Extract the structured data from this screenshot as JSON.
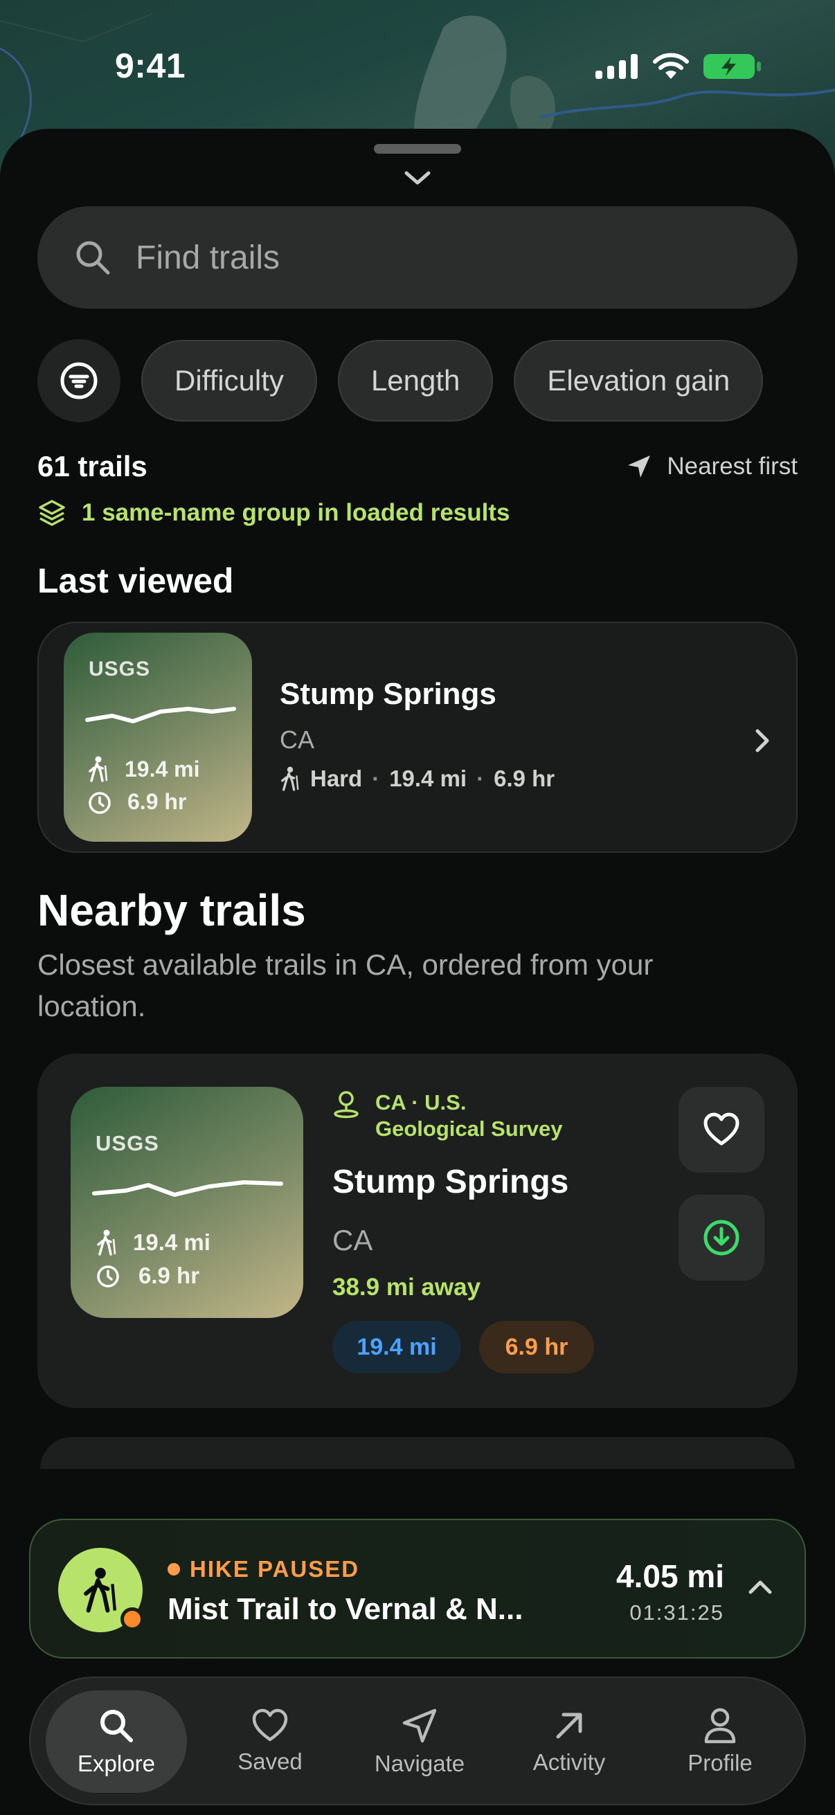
{
  "status_bar": {
    "time": "9:41"
  },
  "search": {
    "placeholder": "Find trails"
  },
  "filters": {
    "chips": [
      "Difficulty",
      "Length",
      "Elevation gain"
    ]
  },
  "results": {
    "count": "61 trails",
    "sort": "Nearest first",
    "group_note": "1 same-name group in loaded results"
  },
  "last_viewed": {
    "heading": "Last viewed",
    "thumb_source": "USGS",
    "thumb_distance": "19.4 mi",
    "thumb_time": "6.9 hr",
    "title": "Stump Springs",
    "state": "CA",
    "difficulty": "Hard",
    "dot": "·",
    "distance": "19.4 mi",
    "time": "6.9 hr"
  },
  "nearby": {
    "heading": "Nearby trails",
    "subtitle": "Closest available trails in CA, ordered from your location.",
    "card": {
      "thumb_source": "USGS",
      "thumb_distance": "19.4 mi",
      "thumb_time": "6.9 hr",
      "location_line1": "CA · U.S.",
      "location_line2": "Geological Survey",
      "title": "Stump Springs",
      "state": "CA",
      "away": "38.9 mi away",
      "pill_distance": "19.4 mi",
      "pill_time": "6.9 hr"
    }
  },
  "hike_banner": {
    "status": "HIKE PAUSED",
    "name": "Mist Trail to Vernal & N...",
    "distance": "4.05 mi",
    "elapsed": "01:31:25"
  },
  "tabs": [
    {
      "label": "Explore",
      "icon": "search-icon"
    },
    {
      "label": "Saved",
      "icon": "heart-icon"
    },
    {
      "label": "Navigate",
      "icon": "navigate-icon"
    },
    {
      "label": "Activity",
      "icon": "arrow-up-right-icon"
    },
    {
      "label": "Profile",
      "icon": "person-icon"
    }
  ],
  "colors": {
    "accent_green": "#b7e36b",
    "paused_orange": "#ff9d4a",
    "distance_blue": "#4ba3ff",
    "download_green": "#3ddc6a"
  }
}
